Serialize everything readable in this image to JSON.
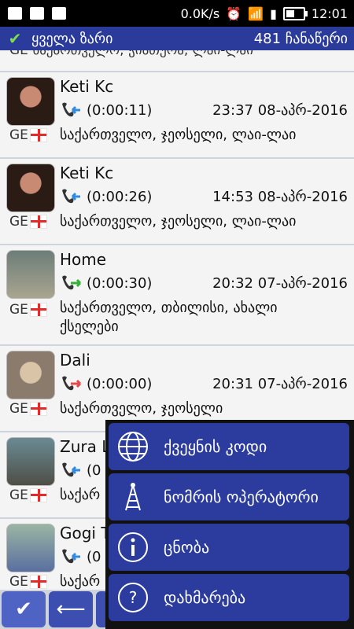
{
  "statusbar": {
    "speed": "0.0K/s",
    "time": "12:01",
    "battery_level": 0.5
  },
  "appbar": {
    "title": "ყველა ზარი",
    "count": "481 ჩანაწერი"
  },
  "partial_top": {
    "text": "GE  საქართველო, ჭიათურა, ლაი-ლაი"
  },
  "rows": [
    {
      "name": "Keti Kc",
      "duration": "(0:00:11)",
      "datetime": "23:37 08-აპრ-2016",
      "country": "GE",
      "location": "საქართველო, ჯეოსელი, ლაი-ლაი",
      "call": "incoming"
    },
    {
      "name": "Keti Kc",
      "duration": "(0:00:26)",
      "datetime": "14:53 08-აპრ-2016",
      "country": "GE",
      "location": "საქართველო, ჯეოსელი, ლაი-ლაი",
      "call": "incoming"
    },
    {
      "name": "Home",
      "duration": "(0:00:30)",
      "datetime": "20:32 07-აპრ-2016",
      "country": "GE",
      "location": "საქართველო, თბილისი, ახალი ქსელები",
      "call": "outgoing"
    },
    {
      "name": "Dali",
      "duration": "(0:00:00)",
      "datetime": "20:31 07-აპრ-2016",
      "country": "GE",
      "location": "საქართველო, ჯეოსელი",
      "call": "missed"
    },
    {
      "name": "Zura L",
      "duration": "(0",
      "datetime": "",
      "country": "GE",
      "location": "საქარ",
      "call": "incoming"
    },
    {
      "name": "Gogi T",
      "duration": "(0",
      "datetime": "",
      "country": "GE",
      "location": "საქარ",
      "call": "incoming"
    }
  ],
  "menu": {
    "items": [
      {
        "label": "ქვეყნის კოდი",
        "icon": "globe-icon"
      },
      {
        "label": "ნომრის ოპერატორი",
        "icon": "antenna-icon"
      },
      {
        "label": "ცნობა",
        "icon": "info-icon"
      },
      {
        "label": "დახმარება",
        "icon": "help-icon"
      }
    ]
  },
  "colors": {
    "appbar": "#2b3b9b",
    "menu_item": "#2c3c9e",
    "incoming_arrow": "#2f8be0",
    "outgoing_arrow": "#35b235",
    "missed": "#e24c4c"
  }
}
